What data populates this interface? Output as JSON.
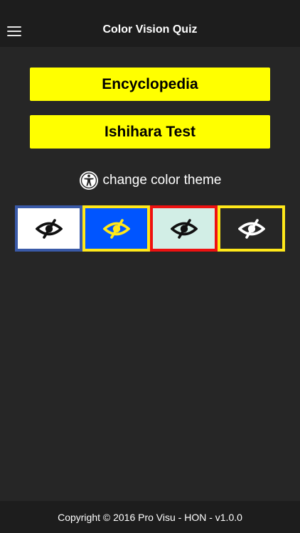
{
  "header": {
    "title": "Color Vision Quiz",
    "menu_icon": "hamburger-menu-icon"
  },
  "buttons": {
    "encyclopedia_label": "Encyclopedia",
    "ishihara_label": "Ishihara Test",
    "background_color": "#ffff00",
    "text_color": "#000000"
  },
  "theme": {
    "label": "change color theme",
    "icon": "accessibility-icon",
    "swatches": [
      {
        "name": "white",
        "background": "#ffffff",
        "border": "#3a5aa8",
        "eye_color": "#111111",
        "icon": "eye-slash-icon"
      },
      {
        "name": "blue",
        "background": "#0055ff",
        "border": "#ffe81a",
        "eye_color": "#ffe81a",
        "icon": "eye-slash-icon"
      },
      {
        "name": "mint",
        "background": "#d2eee6",
        "border": "#ee1111",
        "eye_color": "#111111",
        "icon": "eye-slash-icon"
      },
      {
        "name": "dark",
        "background": "#262626",
        "border": "#ffe81a",
        "eye_color": "#ffffff",
        "icon": "eye-slash-icon"
      }
    ]
  },
  "footer": {
    "text": "Copyright © 2016 Pro Visu - HON - v1.0.0"
  },
  "colors": {
    "app_background": "#262626",
    "bar_background": "#1d1d1d"
  }
}
